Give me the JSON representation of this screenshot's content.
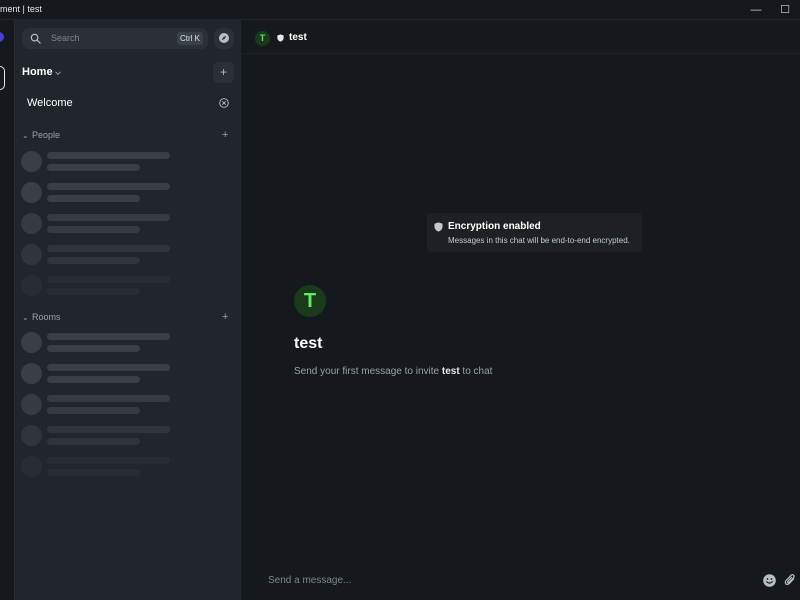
{
  "window": {
    "title": "ment | test",
    "minimize_glyph": "—",
    "maximize_glyph": "☐"
  },
  "icons": {
    "search": "search-icon",
    "explore": "compass-icon",
    "chevron": "chevron-down-icon",
    "add": "plus-icon",
    "close": "close-circle-icon",
    "shield": "shield-icon",
    "emoji": "emoji-icon",
    "attach": "paperclip-icon"
  },
  "sidebar": {
    "search": {
      "placeholder": "Search",
      "shortcut": "Ctrl K"
    },
    "home": {
      "label": "Home",
      "add_glyph": "+"
    },
    "welcome": {
      "label": "Welcome"
    },
    "sections": [
      {
        "label": "People",
        "chevron": "⌄",
        "add_glyph": "+"
      },
      {
        "label": "Rooms",
        "chevron": "⌄",
        "add_glyph": "+"
      }
    ]
  },
  "room": {
    "avatar_letter": "T",
    "name": "test",
    "encryption": {
      "title": "Encryption enabled",
      "subtitle": "Messages in this chat will be end-to-end encrypted."
    },
    "invite": {
      "prefix": "Send your first message to invite ",
      "name": "test",
      "suffix": " to chat"
    }
  },
  "composer": {
    "placeholder": "Send a message..."
  },
  "colors": {
    "background": "#15191e",
    "panel": "#21262c",
    "avatar_green": "#5ee35a",
    "skeleton": "#3a3f46"
  }
}
